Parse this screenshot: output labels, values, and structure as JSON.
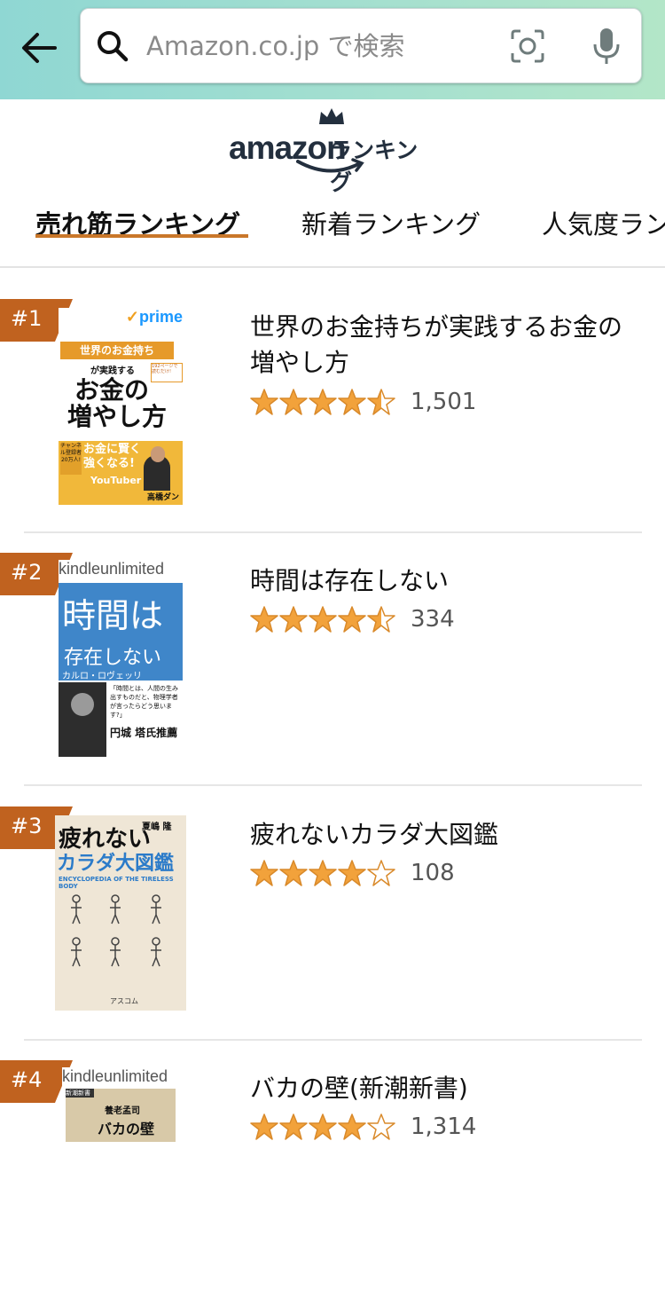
{
  "search": {
    "placeholder": "Amazon.co.jp で検索"
  },
  "logo": {
    "brand": "amazon",
    "suffix": "ランキング"
  },
  "tabs": [
    {
      "label": "売れ筋ランキング",
      "active": true
    },
    {
      "label": "新着ランキング",
      "active": false
    },
    {
      "label": "人気度ランキング",
      "active": false
    }
  ],
  "colors": {
    "accent": "#c9772a",
    "badge": "#c0621f",
    "star": "#f2a23b"
  },
  "items": [
    {
      "rank": "#1",
      "title": "世界のお金持ちが実践するお金の増やし方",
      "rating": 4.5,
      "reviews": "1,501",
      "program": "prime",
      "cover": {
        "top_label": "世界のお金持ち",
        "sub": "が実践する",
        "main1": "お金の",
        "main2": "増やし方",
        "banner": "お金に賢く強くなる!",
        "badge": "チャンネル登録者 20万人!",
        "corner": "192ページで読むだけ!",
        "yt": "YouTuber",
        "author": "高橋ダン"
      }
    },
    {
      "rank": "#2",
      "title": "時間は存在しない",
      "rating": 4.5,
      "reviews": "334",
      "program": "kindleunlimited",
      "cover": {
        "main1": "時間は",
        "main2": "存在しない",
        "author": "カルロ・ロヴェッリ",
        "quote": "「時間とは、人間の生み出すものだと、物理学者が言ったらどう思います?」",
        "blurb": "円城 塔氏推薦"
      }
    },
    {
      "rank": "#3",
      "title": "疲れないカラダ大図鑑",
      "rating": 4.0,
      "reviews": "108",
      "program": "",
      "cover": {
        "main1": "疲れない",
        "main2": "カラダ大図鑑",
        "english": "ENCYCLOPEDIA OF THE TIRELESS BODY",
        "author": "夏嶋 隆",
        "publisher": "アスコム"
      }
    },
    {
      "rank": "#4",
      "title": "バカの壁(新潮新書)",
      "rating": 4.0,
      "reviews": "1,314",
      "program": "kindleunlimited",
      "cover": {
        "series": "新潮新書",
        "author": "養老孟司",
        "main1": "バカの壁"
      }
    }
  ]
}
